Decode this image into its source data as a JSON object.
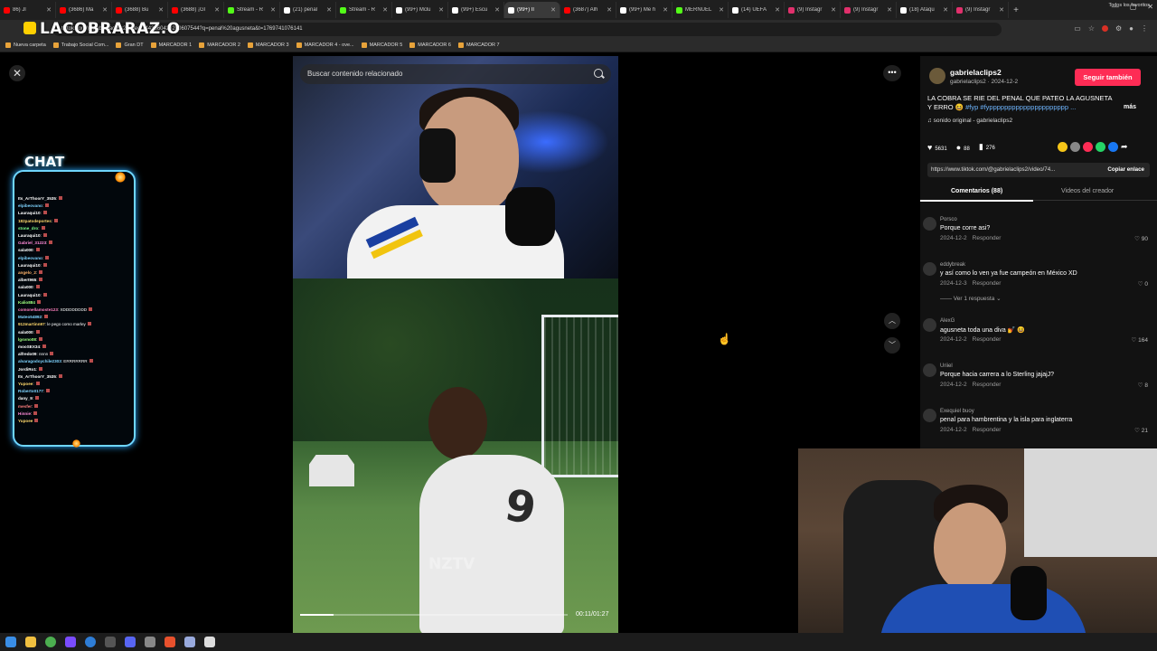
{
  "browser": {
    "tabs": [
      {
        "label": "86) Jl",
        "color": "#ff0000"
      },
      {
        "label": "(3686) Ma",
        "color": "#ff0000"
      },
      {
        "label": "(3688) Bu",
        "color": "#ff0000"
      },
      {
        "label": "(3688) ¡Gl",
        "color": "#ff0000"
      },
      {
        "label": "Stream - R",
        "color": "#53fc18"
      },
      {
        "label": "(21) penal",
        "color": "#ffffff"
      },
      {
        "label": "Stream - R",
        "color": "#53fc18"
      },
      {
        "label": "(99+) Mclu",
        "color": "#ffffff"
      },
      {
        "label": "(99+) Escu",
        "color": "#ffffff"
      },
      {
        "label": "(99+) Il",
        "color": "#ffffff",
        "active": true
      },
      {
        "label": "(3687) Alh",
        "color": "#ff0000"
      },
      {
        "label": "(99+) Me h",
        "color": "#ffffff"
      },
      {
        "label": "MERNUEL",
        "color": "#53fc18"
      },
      {
        "label": "(14) UEFA",
        "color": "#ffffff"
      },
      {
        "label": "(9) Instagr",
        "color": "#e1306c"
      },
      {
        "label": "(9) Instagr",
        "color": "#e1306c"
      },
      {
        "label": "(18) Ataqu",
        "color": "#ffffff"
      },
      {
        "label": "(9) Instagr",
        "color": "#e1306c"
      }
    ],
    "url": "tiktok.com/@gabrielaclips2/video/7443660423200607544?q=penal%20agusneta&t=1769741076141",
    "bookmarks": [
      "Nueva carpeta",
      "Trabajo Social Com...",
      "Gran DT",
      "MARCADOR 1",
      "MARCADOR 2",
      "MARCADOR 3",
      "MARCADOR 4 - ove...",
      "MARCADOR 5",
      "MARCADOR 6",
      "MARCADOR 7"
    ],
    "bookmarks_right": "Todos los favoritos"
  },
  "overlay": {
    "logo": "LACOBRARAZ.O",
    "chat_title": "CHAT",
    "chat_lines": [
      {
        "user": "Its_ArThoorY_3535",
        "msg": ":",
        "color": "#ffffff"
      },
      {
        "user": "elpibeovano",
        "msg": ":",
        "color": "#7fd4ff"
      },
      {
        "user": "Lauraqui10",
        "msg": ":",
        "color": "#ffffff"
      },
      {
        "user": "182patodeportes",
        "msg": ":",
        "color": "#ffd86b"
      },
      {
        "user": "stone_dro",
        "msg": ":",
        "color": "#7fff8a"
      },
      {
        "user": "Lauraqui10",
        "msg": ":",
        "color": "#ffffff"
      },
      {
        "user": "Gabriel_31223",
        "msg": ":",
        "color": "#ff8ad8"
      },
      {
        "user": "sala000",
        "msg": ":",
        "color": "#ffffff"
      },
      {
        "user": "elpibeovano",
        "msg": ":",
        "color": "#7fd4ff"
      },
      {
        "user": "Lauraqui10",
        "msg": ":",
        "color": "#ffffff"
      },
      {
        "user": "angelo_2",
        "msg": ":",
        "color": "#ffb36b"
      },
      {
        "user": "albert965",
        "msg": ":",
        "color": "#ffffff"
      },
      {
        "user": "sala000",
        "msg": ":",
        "color": "#ffffff"
      },
      {
        "user": "Lauraqui10",
        "msg": ":",
        "color": "#ffffff"
      },
      {
        "user": "Kalio884",
        "msg": "",
        "color": "#a0ff7f"
      },
      {
        "user": "comonellamoste123",
        "msg": ": XDDDDDDDD",
        "color": "#ff7fbf"
      },
      {
        "user": "Mateo54892",
        "msg": ":",
        "color": "#7fd4ff"
      },
      {
        "user": "912martinn97",
        "msg": ": le pego como marley",
        "color": "#ffd86b"
      },
      {
        "user": "sala000",
        "msg": ":",
        "color": "#ffffff"
      },
      {
        "user": "lgsvno08",
        "msg": ":",
        "color": "#a0ff7f"
      },
      {
        "user": "mooSEX34",
        "msg": ":",
        "color": "#ffffff"
      },
      {
        "user": "alfredo09",
        "msg": ": nnnn",
        "color": "#ffffff"
      },
      {
        "user": "alvaragodoychile2303",
        "msg": ": ERRRRRRR",
        "color": "#7fd4ff"
      },
      {
        "user": "JordiRo1",
        "msg": ":",
        "color": "#ffffff"
      },
      {
        "user": "Its_ArThoorY_3535",
        "msg": ":",
        "color": "#ffffff"
      },
      {
        "user": "Yupoee",
        "msg": ":",
        "color": "#ffd86b"
      },
      {
        "user": "Roberto0177",
        "msg": ":",
        "color": "#7fd4ff"
      },
      {
        "user": "dany_9",
        "msg": ":",
        "color": "#ffffff"
      },
      {
        "user": "mesfer",
        "msg": ":",
        "color": "#ff7f7f"
      },
      {
        "user": "Hinnie",
        "msg": ":",
        "color": "#ff8ad8"
      },
      {
        "user": "Yupoee",
        "msg": "",
        "color": "#ffd86b"
      }
    ]
  },
  "video": {
    "search_placeholder": "Buscar contenido relacionado",
    "watermark": "NZTV",
    "time": "00:11/01:27",
    "progress_fraction": 0.126
  },
  "post": {
    "author": "gabrielaclips2",
    "author_sub": "gabrielaclips2 · 2024-12-2",
    "follow_label": "Seguir también",
    "description": "LA COBRA SE RIE DEL PENAL QUE PATEO LA AGUSNETA Y ERRO 😆 ",
    "tags": "#fyp #fyppppppppppppppppppppp ...",
    "more": "más",
    "sound": "♫  sonido original - gabrielaclips2",
    "likes": "5631",
    "comments": "88",
    "saves": "276",
    "share_colors": [
      "#f5c518",
      "#888888",
      "#fe2c55",
      "#25d366",
      "#1877f2"
    ],
    "link": "https://www.tiktok.com/@gabrielaclips2/video/74...",
    "copy_label": "Copiar enlace",
    "tab_comments": "Comentarios (88)",
    "tab_creator": "Videos del creador"
  },
  "comments": [
    {
      "user": "Porsco",
      "text": "Porque corre asi?",
      "date": "2024-12-2",
      "reply": "Responder",
      "likes": "90"
    },
    {
      "user": "eddybreak",
      "text": "y así como lo ven ya fue campeón en México XD",
      "date": "2024-12-3",
      "reply": "Responder",
      "likes": "0"
    },
    {
      "user": "AlexG",
      "text": "agusneta toda una diva 💅 😆",
      "date": "2024-12-2",
      "reply": "Responder",
      "likes": "164"
    },
    {
      "user": "Uriiel",
      "text": "Porque hacia carrera a lo Sterling jajajJ?",
      "date": "2024-12-2",
      "reply": "Responder",
      "likes": "8"
    },
    {
      "user": "Exequiel buoy",
      "text": "penal para hambrentina y la isla para inglaterra",
      "date": "2024-12-2",
      "reply": "Responder",
      "likes": "21"
    }
  ],
  "view_replies": "——  Ver 1 respuesta ⌄"
}
